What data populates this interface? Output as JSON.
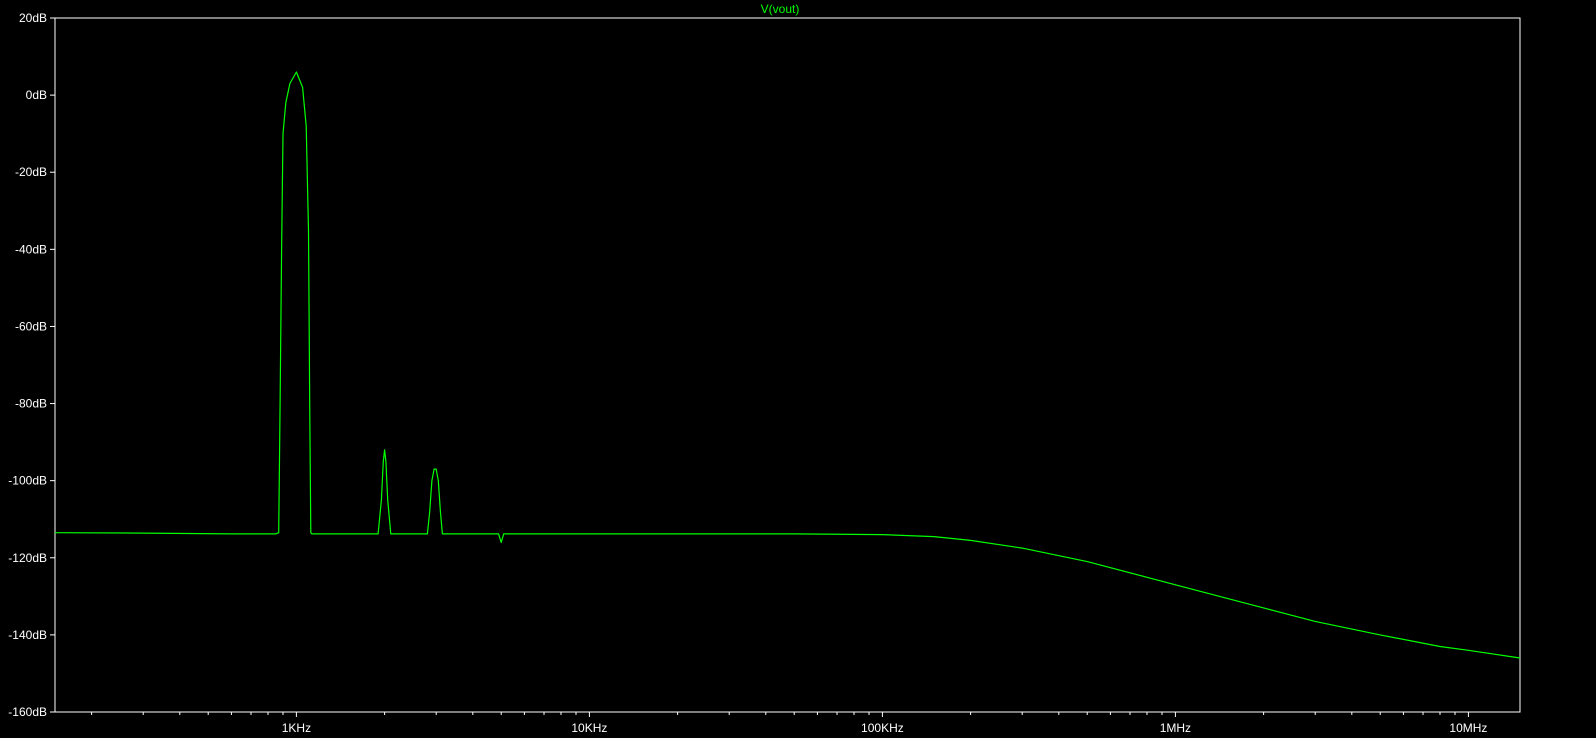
{
  "chart_data": {
    "type": "line",
    "title": "V(vout)",
    "xlabel": "",
    "ylabel": "",
    "x_scale": "log",
    "xlim": [
      150,
      15000000
    ],
    "ylim": [
      -160,
      20
    ],
    "grid": false,
    "colors": {
      "background": "#000000",
      "axes": "#ffffff",
      "trace": "#00ff00",
      "title": "#00ff00"
    },
    "x_ticks": [
      {
        "value": 1000,
        "label": "1KHz"
      },
      {
        "value": 10000,
        "label": "10KHz"
      },
      {
        "value": 100000,
        "label": "100KHz"
      },
      {
        "value": 1000000,
        "label": "1MHz"
      },
      {
        "value": 10000000,
        "label": "10MHz"
      }
    ],
    "y_ticks": [
      {
        "value": 20,
        "label": "20dB"
      },
      {
        "value": 0,
        "label": "0dB"
      },
      {
        "value": -20,
        "label": "-20dB"
      },
      {
        "value": -40,
        "label": "-40dB"
      },
      {
        "value": -60,
        "label": "-60dB"
      },
      {
        "value": -80,
        "label": "-80dB"
      },
      {
        "value": -100,
        "label": "-100dB"
      },
      {
        "value": -120,
        "label": "-120dB"
      },
      {
        "value": -140,
        "label": "-140dB"
      },
      {
        "value": -160,
        "label": "-160dB"
      }
    ],
    "series": [
      {
        "name": "V(vout)",
        "x": [
          150,
          300,
          600,
          850,
          870,
          880,
          890,
          900,
          920,
          950,
          1000,
          1050,
          1080,
          1100,
          1110,
          1120,
          1130,
          1150,
          1900,
          1950,
          1980,
          2000,
          2020,
          2050,
          2100,
          2800,
          2850,
          2900,
          2950,
          3000,
          3050,
          3100,
          3150,
          3300,
          4900,
          5000,
          5100,
          6000,
          10000,
          20000,
          50000,
          100000,
          150000,
          200000,
          300000,
          500000,
          1000000,
          2000000,
          3000000,
          5000000,
          8000000,
          10000000,
          15000000
        ],
        "y": [
          -113.5,
          -113.6,
          -113.8,
          -113.8,
          -113.5,
          -80,
          -40,
          -10,
          -2,
          3,
          6,
          2,
          -8,
          -35,
          -80,
          -113.5,
          -113.8,
          -113.8,
          -113.8,
          -105,
          -95,
          -92,
          -95,
          -105,
          -113.8,
          -113.8,
          -108,
          -100,
          -97,
          -97,
          -100,
          -108,
          -113.8,
          -113.8,
          -113.8,
          -116,
          -113.8,
          -113.8,
          -113.8,
          -113.8,
          -113.8,
          -114,
          -114.5,
          -115.5,
          -117.5,
          -121,
          -127,
          -133,
          -136.5,
          -140,
          -143,
          -144,
          -146
        ]
      }
    ]
  }
}
